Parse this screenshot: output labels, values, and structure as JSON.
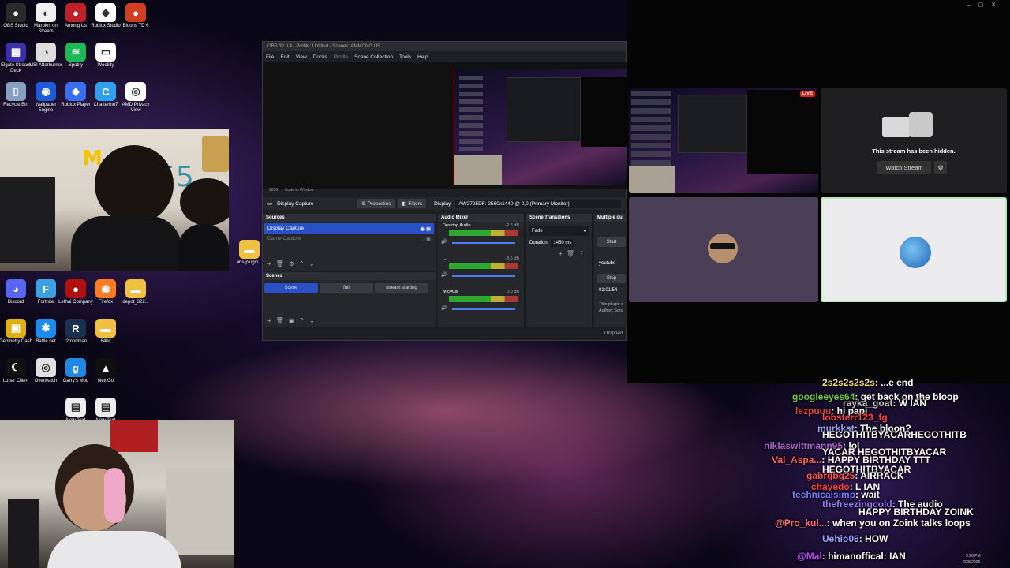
{
  "desktop": {
    "icons": [
      {
        "label": "OBS Studio",
        "color": "#2a2a2a",
        "glyph": "●"
      },
      {
        "label": "Marbles on Stream",
        "color": "#f0f0f0",
        "glyph": "◐"
      },
      {
        "label": "Among Us",
        "color": "#c0202a",
        "glyph": "●"
      },
      {
        "label": "Roblox Studio",
        "color": "#ffffff",
        "glyph": "◆"
      },
      {
        "label": "Bloons TD 6",
        "color": "#d04020",
        "glyph": "●"
      },
      {
        "label": "Elgato Stream Deck",
        "color": "#3b2fb0",
        "glyph": "▦"
      },
      {
        "label": "MSI Afterburner",
        "color": "#dddddd",
        "glyph": "◔"
      },
      {
        "label": "Spotify",
        "color": "#1db954",
        "glyph": "≋"
      },
      {
        "label": "Woolilty",
        "color": "#ffffff",
        "glyph": "▭"
      },
      {
        "label": "Recycle Bin",
        "color": "#88a0c0",
        "glyph": "▯"
      },
      {
        "label": "Wallpaper Engine",
        "color": "#1f5bd6",
        "glyph": "◉"
      },
      {
        "label": "Roblox Player",
        "color": "#3a6ef0",
        "glyph": "◆"
      },
      {
        "label": "Chatterino7",
        "color": "#2fa0f0",
        "glyph": "C"
      },
      {
        "label": "AMD Privacy View",
        "color": "#ffffff",
        "glyph": "◎"
      },
      {
        "label": "Discord",
        "color": "#5865f2",
        "glyph": "◕"
      },
      {
        "label": "Fortnite",
        "color": "#3aa0e0",
        "glyph": "F"
      },
      {
        "label": "Lethal Company",
        "color": "#b01010",
        "glyph": "●"
      },
      {
        "label": "Firefox",
        "color": "#ff7a20",
        "glyph": "◉"
      },
      {
        "label": "depot_322...",
        "color": "#f0c040",
        "glyph": "▬"
      },
      {
        "label": "Geometry Dash",
        "color": "#e0b010",
        "glyph": "▣"
      },
      {
        "label": "Battle.net",
        "color": "#1a8cf0",
        "glyph": "✱"
      },
      {
        "label": "r2modman",
        "color": "#1a3050",
        "glyph": "R"
      },
      {
        "label": "64bit",
        "color": "#f0c040",
        "glyph": "▬"
      },
      {
        "label": "Lunar Client",
        "color": "#111111",
        "glyph": "☾"
      },
      {
        "label": "Overwatch",
        "color": "#e0e0e0",
        "glyph": "◎"
      },
      {
        "label": "Garry's Mod",
        "color": "#1e88e5",
        "glyph": "g"
      },
      {
        "label": "NexiGo",
        "color": "#101010",
        "glyph": "▲"
      },
      {
        "label": "obs-plugin...",
        "color": "#f0c040",
        "glyph": "▬"
      },
      {
        "label": "New Text",
        "color": "#eeeeee",
        "glyph": "▤"
      },
      {
        "label": "New Text",
        "color": "#eeeeee",
        "glyph": "▤"
      }
    ]
  },
  "obs": {
    "title": "OBS 32.0.4 - Profile: Untitled - Scenes: AMMONG US",
    "menu": [
      "File",
      "Edit",
      "View",
      "Docks",
      "Profile",
      "Scene Collection",
      "Tools",
      "Help"
    ],
    "zoom": "2816",
    "scale_label": "Scale to Window",
    "source_label": "Display Capture",
    "properties": "Properties",
    "filters": "Filters",
    "display_label": "Display",
    "display_value": "AW2725DF: 2560x1440 @ 0,0 (Primary Monitor)",
    "panels": {
      "sources": "Sources",
      "mixer": "Audio Mixer",
      "transitions": "Scene Transitions",
      "multi": "Multiple ou",
      "scenes": "Scenes"
    },
    "sources": [
      "Display Capture",
      "Game Capture"
    ],
    "scenes": [
      "Scene",
      "full",
      "stream starting"
    ],
    "mixer": [
      {
        "name": "Desktop Audio",
        "db": "-2.6 dB"
      },
      {
        "name": "...",
        "db": "-3.6 dB"
      },
      {
        "name": "Mic/Aux",
        "db": "0.0 dB"
      }
    ],
    "transition": "Fade",
    "duration_label": "Duration",
    "duration": "1450 ms",
    "multi": {
      "start": "Start",
      "youtube": "youtube",
      "stop": "Stop",
      "time": "01:01:54",
      "plugin": "This plugin s",
      "author": "Author: Sora"
    },
    "dropped": "Dropped"
  },
  "stream": {
    "live": "LIVE",
    "hidden_text": "This stream has been hidden.",
    "watch": "Watch Stream"
  },
  "chat": [
    {
      "user": "2s2s2s2s2s",
      "msg": "...e end",
      "color": "#f0e070"
    },
    {
      "user": "googleeyes64",
      "msg": "get back on the bloop",
      "color": "#6acb3a"
    },
    {
      "user": "rayka_goat",
      "msg": "W IAN",
      "color": "#c8c8c8"
    },
    {
      "user": "lezpuuu",
      "msg": "hi papi",
      "color": "#e04040"
    },
    {
      "user": "lobsterr123_fg",
      "msg": "",
      "color": "#ff4040"
    },
    {
      "user": "murkkat",
      "msg": "The bloon?",
      "color": "#9aa7ff"
    },
    {
      "user": "",
      "msg": "HEGOTHITBYACARHEGOTHITB",
      "color": "#ffffff"
    },
    {
      "user": "niklaswittmann95",
      "msg": "lol",
      "color": "#b060d0"
    },
    {
      "user": "",
      "msg": "YACAR HEGOTHITBYACAR",
      "color": "#ffffff"
    },
    {
      "user": "Val_Aspa...",
      "msg": "HAPPY BIRTHDAY TTT",
      "color": "#ff6060"
    },
    {
      "user": "",
      "msg": "HEGOTHITBYACAR",
      "color": "#ffffff"
    },
    {
      "user": "gabrgbg25",
      "msg": "AIRRACK",
      "color": "#ff5050"
    },
    {
      "user": "chayedo",
      "msg": "L IAN",
      "color": "#ff4040"
    },
    {
      "user": "technicalsimp",
      "msg": "wait",
      "color": "#7a7aff"
    },
    {
      "user": "thefreezingcold",
      "msg": "The audio",
      "color": "#9a7aff"
    },
    {
      "user": "",
      "msg": "HAPPY BIRTHDAY ZOINK",
      "color": "#ffffff"
    },
    {
      "user": "@Pro_kul...",
      "msg": "when you on Zoink talks loops",
      "color": "#ff7070"
    },
    {
      "user": "Uehio06",
      "msg": "HOW",
      "color": "#9aa0ff"
    },
    {
      "user": "@Mal",
      "msg": "himanoffical: IAN",
      "color": "#c040ff"
    }
  ],
  "taskbar": {
    "time": "3:26 PM",
    "date": "2/28/2026"
  }
}
